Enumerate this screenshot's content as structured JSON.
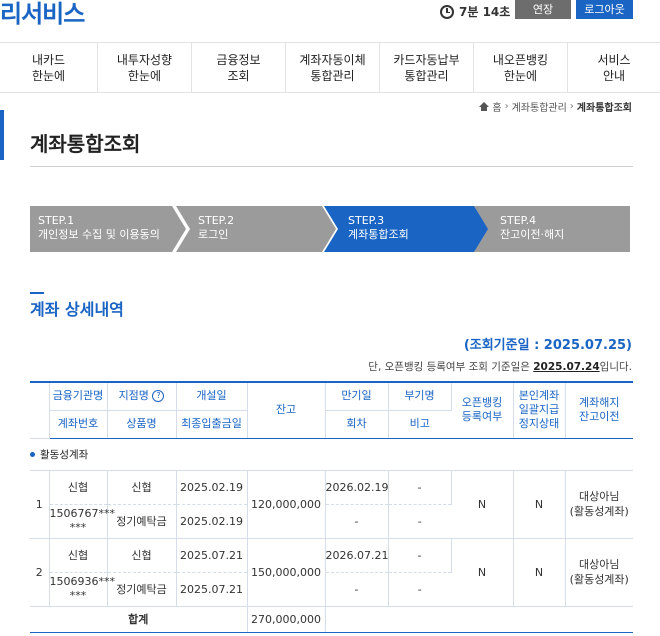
{
  "header": {
    "logo_text": "리서비스",
    "timer": "7분 14초",
    "extend_label": "연장",
    "logout_label": "로그아웃"
  },
  "nav": {
    "items": [
      "내카드\n한눈에",
      "내투자성향\n한눈에",
      "금융정보\n조회",
      "계좌자동이체\n통합관리",
      "카드자동납부\n통합관리",
      "내오픈뱅킹\n한눈에",
      "서비스\n안내"
    ]
  },
  "breadcrumb": {
    "home": "홈",
    "level1": "계좌통합관리",
    "current": "계좌통합조회"
  },
  "page": {
    "title": "계좌통합조회"
  },
  "steps": [
    {
      "num": "STEP.1",
      "label": "개인정보 수집 및 이용동의"
    },
    {
      "num": "STEP.2",
      "label": "로그인"
    },
    {
      "num": "STEP.3",
      "label": "계좌통합조회"
    },
    {
      "num": "STEP.4",
      "label": "잔고이전·해지"
    }
  ],
  "section": {
    "title": "계좌 상세내역",
    "ref_date": "(조회기준일 : 2025.07.25)",
    "note_prefix": "단, 오픈뱅킹 등록여부 조회 기준일은 ",
    "note_date": "2025.07.24",
    "note_suffix": "입니다."
  },
  "table": {
    "headers": {
      "institution": "금융기관명",
      "account_no": "계좌번호",
      "branch": "지점명",
      "help": "?",
      "product": "상품명",
      "open_date": "개설일",
      "last_tx_date": "최종입출금일",
      "balance": "잔고",
      "maturity": "만기일",
      "round": "회차",
      "subscription": "부기명",
      "remarks": "비고",
      "openbanking": "오픈뱅킹\n등록여부",
      "self_account": "본인계좌\n일괄지급\n정지상태",
      "close": "계좌해지\n잔고이전"
    },
    "group_label": "활동성계좌",
    "rows": [
      {
        "no": "1",
        "institution": "신협",
        "account_no": "1506767***\n***",
        "branch": "신협",
        "product": "정기예탁금",
        "open_date": "2025.02.19",
        "last_tx_date": "2025.02.19",
        "balance": "120,000,000",
        "maturity": "2026.02.19",
        "round": "-",
        "subscription": "-",
        "remarks": "-",
        "openbanking": "N",
        "self_account": "N",
        "close": "대상아님\n(활동성계좌)"
      },
      {
        "no": "2",
        "institution": "신협",
        "account_no": "1506936***\n***",
        "branch": "신협",
        "product": "정기예탁금",
        "open_date": "2025.07.21",
        "last_tx_date": "2025.07.21",
        "balance": "150,000,000",
        "maturity": "2026.07.21",
        "round": "-",
        "subscription": "-",
        "remarks": "-",
        "openbanking": "N",
        "self_account": "N",
        "close": "대상아님\n(활동성계좌)"
      }
    ],
    "total_label": "합계",
    "total_balance": "270,000,000"
  },
  "colors": {
    "brand": "#1a64c4",
    "step_inactive": "#9b9b9b",
    "extend_button": "#6d6d6d"
  }
}
